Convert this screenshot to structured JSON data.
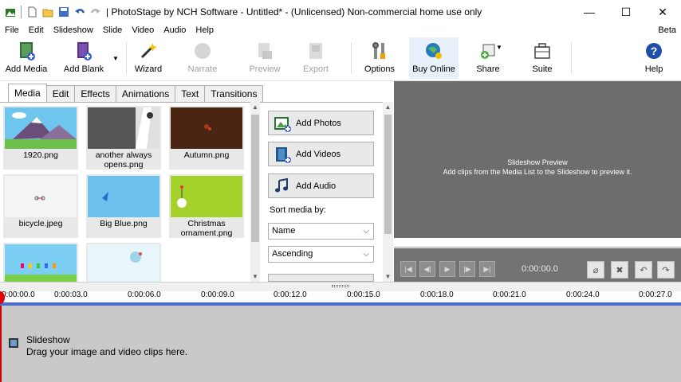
{
  "window": {
    "title": "| PhotoStage by NCH Software - Untitled* - (Unlicensed) Non-commercial home use only",
    "minimize": "—",
    "maximize": "☐",
    "close": "✕"
  },
  "menu": {
    "items": [
      "File",
      "Edit",
      "Slideshow",
      "Slide",
      "Video",
      "Audio",
      "Help"
    ],
    "beta": "Beta"
  },
  "toolbar": {
    "add_media": "Add Media",
    "add_blank": "Add Blank",
    "wizard": "Wizard",
    "narrate": "Narrate",
    "preview": "Preview",
    "export": "Export",
    "options": "Options",
    "buy_online": "Buy Online",
    "share": "Share",
    "suite": "Suite",
    "help": "Help"
  },
  "tabs": [
    "Media",
    "Edit",
    "Effects",
    "Animations",
    "Text",
    "Transitions"
  ],
  "media": {
    "items": [
      {
        "label": "1920.png"
      },
      {
        "label": "another always opens.png"
      },
      {
        "label": "Autumn.png"
      },
      {
        "label": "bicycle.jpeg"
      },
      {
        "label": "Big Blue.png"
      },
      {
        "label": "Christmas ornament.png"
      }
    ]
  },
  "media_actions": {
    "add_photos": "Add Photos",
    "add_videos": "Add Videos",
    "add_audio": "Add Audio",
    "sort_label": "Sort media by:",
    "sort_by": "Name",
    "sort_order": "Ascending"
  },
  "preview": {
    "title": "Slideshow Preview",
    "hint": "Add clips from the Media List to the Slideshow to preview it.",
    "time": "0:00:00.0"
  },
  "timeline": {
    "ticks": [
      "0:00:00.0",
      "0:00:03.0",
      "0:00:06.0",
      "0:00:09.0",
      "0:00:12.0",
      "0:00:15.0",
      "0:00:18.0",
      "0:00:21.0",
      "0:00:24.0",
      "0:00:27.0"
    ],
    "track_title": "Slideshow",
    "track_hint": "Drag your image and video clips here."
  },
  "colors": {
    "accent": "#4a6fd1",
    "preview_bg": "#6d6d6d",
    "playhead": "#e00000"
  }
}
